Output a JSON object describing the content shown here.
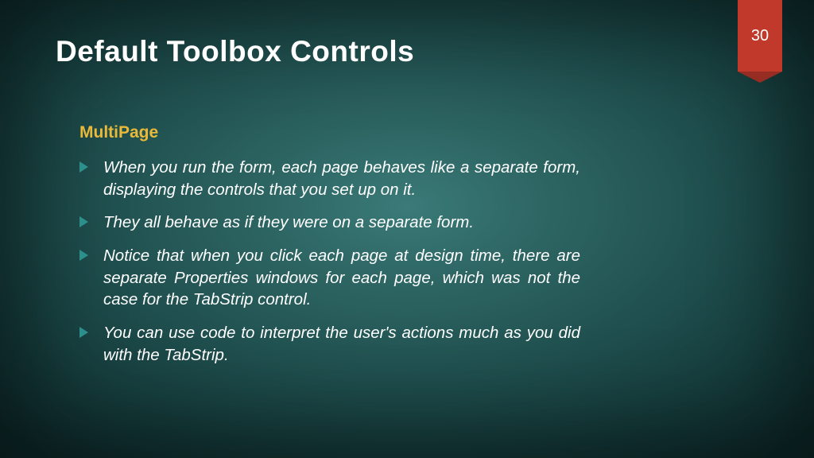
{
  "slide": {
    "title": "Default Toolbox Controls",
    "page_number": "30",
    "section_heading": "MultiPage",
    "bullets": [
      "When you run the form, each page behaves like a separate form, displaying the controls that you set up on it.",
      "They all behave as if they were on a separate form.",
      "Notice that when you click each page at design time, there are separate Properties windows for each page, which was not the case for the TabStrip control.",
      "You can use code to interpret the user's actions much as you did with the TabStrip."
    ]
  }
}
